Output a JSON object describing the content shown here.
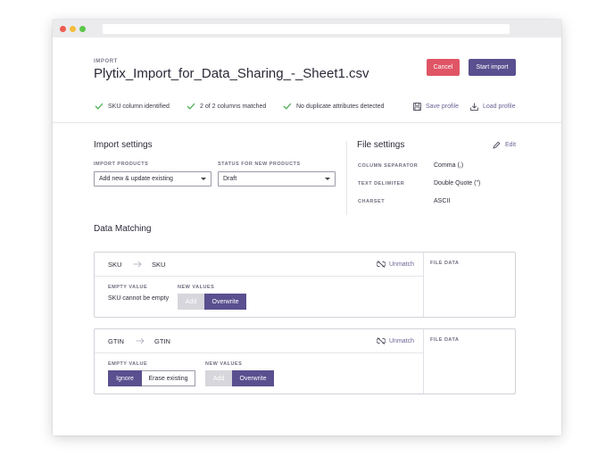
{
  "header": {
    "eyebrow": "IMPORT",
    "filename": "Plytix_Import_for_Data_Sharing_-_Sheet1.csv",
    "cancel_label": "Cancel",
    "start_label": "Start import"
  },
  "checks": [
    {
      "label": "SKU column identified"
    },
    {
      "label": "2 of 2 columns matched"
    },
    {
      "label": "No duplicate attributes detected"
    }
  ],
  "toolbar": {
    "save_profile": "Save profile",
    "load_profile": "Load profile"
  },
  "import_settings": {
    "title": "Import settings",
    "import_products_label": "IMPORT PRODUCTS",
    "import_products_value": "Add new & update existing",
    "status_label": "STATUS FOR NEW PRODUCTS",
    "status_value": "Draft"
  },
  "file_settings": {
    "title": "File settings",
    "edit_label": "Edit",
    "rows": [
      {
        "key": "COLUMN SEPARATOR",
        "value": "Comma (,)"
      },
      {
        "key": "TEXT DELIMITER",
        "value": "Double Quote (\")"
      },
      {
        "key": "CHARSET",
        "value": "ASCII"
      }
    ]
  },
  "data_matching": {
    "title": "Data Matching",
    "cards": [
      {
        "source": "SKU",
        "target": "SKU",
        "unmatch_label": "Unmatch",
        "file_data_label": "FILE DATA",
        "empty_value_label": "EMPTY VALUE",
        "empty_value_note": "SKU cannot be empty",
        "new_values_label": "NEW VALUES",
        "new_values_options": [
          "Add",
          "Overwrite"
        ]
      },
      {
        "source": "GTIN",
        "target": "GTIN",
        "unmatch_label": "Unmatch",
        "file_data_label": "FILE DATA",
        "empty_value_label": "EMPTY VALUE",
        "empty_value_options": [
          "Ignore",
          "Erase existing"
        ],
        "new_values_label": "NEW VALUES",
        "new_values_options": [
          "Add",
          "Overwrite"
        ]
      }
    ]
  },
  "colors": {
    "accent": "#5a4f8f",
    "cancel": "#e05566",
    "check": "#4caf50"
  },
  "icons": {
    "check": "check-icon",
    "save": "save-icon",
    "load": "download-icon",
    "edit": "pencil-icon",
    "unmatch": "unlink-icon",
    "arrow": "arrow-right-icon"
  }
}
